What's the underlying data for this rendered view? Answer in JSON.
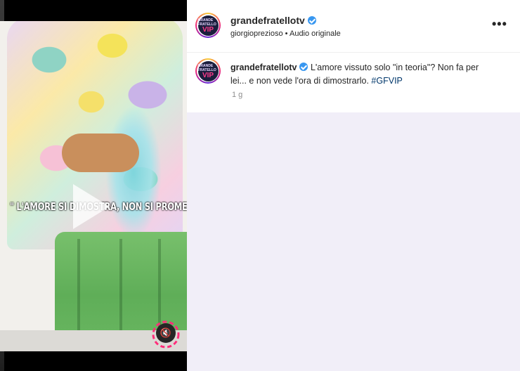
{
  "media": {
    "overlay_caption": "\" L'AMORE SI DIMOSTRA, NON SI PROMETTE \"",
    "play_icon": "play-icon",
    "mute_icon": "speaker-muted-icon",
    "mute_symbol": "🔇"
  },
  "header": {
    "username": "grandefratellotv",
    "verified_icon": "verified-badge-icon",
    "audio_author": "giorgioprezioso",
    "audio_separator": "•",
    "audio_label": "Audio originale",
    "more_label": "•••"
  },
  "avatar": {
    "top_text": "GRANDE FRATELLO",
    "main_text": "VIP"
  },
  "post": {
    "author": "grandefratellotv",
    "caption": "L'amore vissuto solo \"in teoria\"? Non fa per lei... e non vede l'ora di dimostrarlo.",
    "hashtag": "#GFVIP",
    "time": "1 g"
  },
  "colors": {
    "verified": "#3897f0",
    "hashtag": "#00376b",
    "panel_background": "#f1eef8"
  }
}
